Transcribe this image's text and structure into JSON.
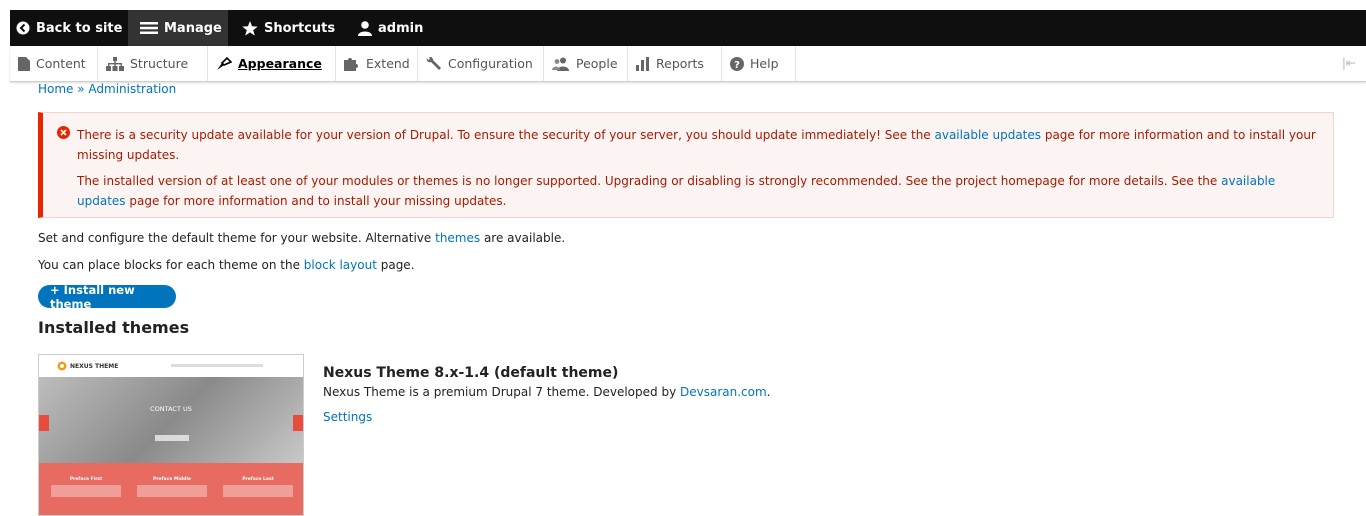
{
  "toolbar": {
    "back_to_site": "Back to site",
    "manage": "Manage",
    "shortcuts": "Shortcuts",
    "user": "admin"
  },
  "tray": {
    "items": [
      {
        "label": "Content",
        "icon": "file-icon"
      },
      {
        "label": "Structure",
        "icon": "sitemap-icon"
      },
      {
        "label": "Appearance",
        "icon": "paintbrush-icon",
        "active": true
      },
      {
        "label": "Extend",
        "icon": "puzzle-icon"
      },
      {
        "label": "Configuration",
        "icon": "wrench-icon"
      },
      {
        "label": "People",
        "icon": "people-icon"
      },
      {
        "label": "Reports",
        "icon": "bar-chart-icon"
      },
      {
        "label": "Help",
        "icon": "help-icon"
      }
    ],
    "collapse": "|⇤"
  },
  "breadcrumb": {
    "home": "Home",
    "separator": " » ",
    "administration": "Administration"
  },
  "messages": {
    "msg1_before": "There is a security update available for your version of Drupal. To ensure the security of your server, you should update immediately! See the ",
    "msg1_link": "available updates",
    "msg1_after": " page for more information and to install your missing updates.",
    "msg2_before": "The installed version of at least one of your modules or themes is no longer supported. Upgrading or disabling is strongly recommended. See the project homepage for more details. See the ",
    "msg2_link": "available updates",
    "msg2_after": " page for more information and to install your missing updates."
  },
  "intro": {
    "line1_before": "Set and configure the default theme for your website. Alternative ",
    "line1_link": "themes",
    "line1_after": " are available.",
    "line2_before": "You can place blocks for each theme on the ",
    "line2_link": "block layout",
    "line2_after": " page."
  },
  "install_button": "+ Install new theme",
  "installed_title": "Installed themes",
  "theme": {
    "name": "Nexus Theme 8.x-1.4 (default theme)",
    "desc_before": "Nexus Theme is a premium Drupal 7 theme. Developed by ",
    "desc_link": "Devsaran.com",
    "desc_after": ".",
    "settings": "Settings",
    "screenshot": {
      "logo_text": "NEXUS THEME",
      "hero_title": "CONTACT US",
      "col1": "Preface First",
      "col2": "Preface Middle",
      "col3": "Preface Last"
    }
  },
  "colors": {
    "toolbar_bg": "#0f0f0f",
    "link": "#0074bd",
    "error_text": "#a51b00",
    "error_border": "#e62600",
    "error_bg": "#fcf4f2"
  }
}
